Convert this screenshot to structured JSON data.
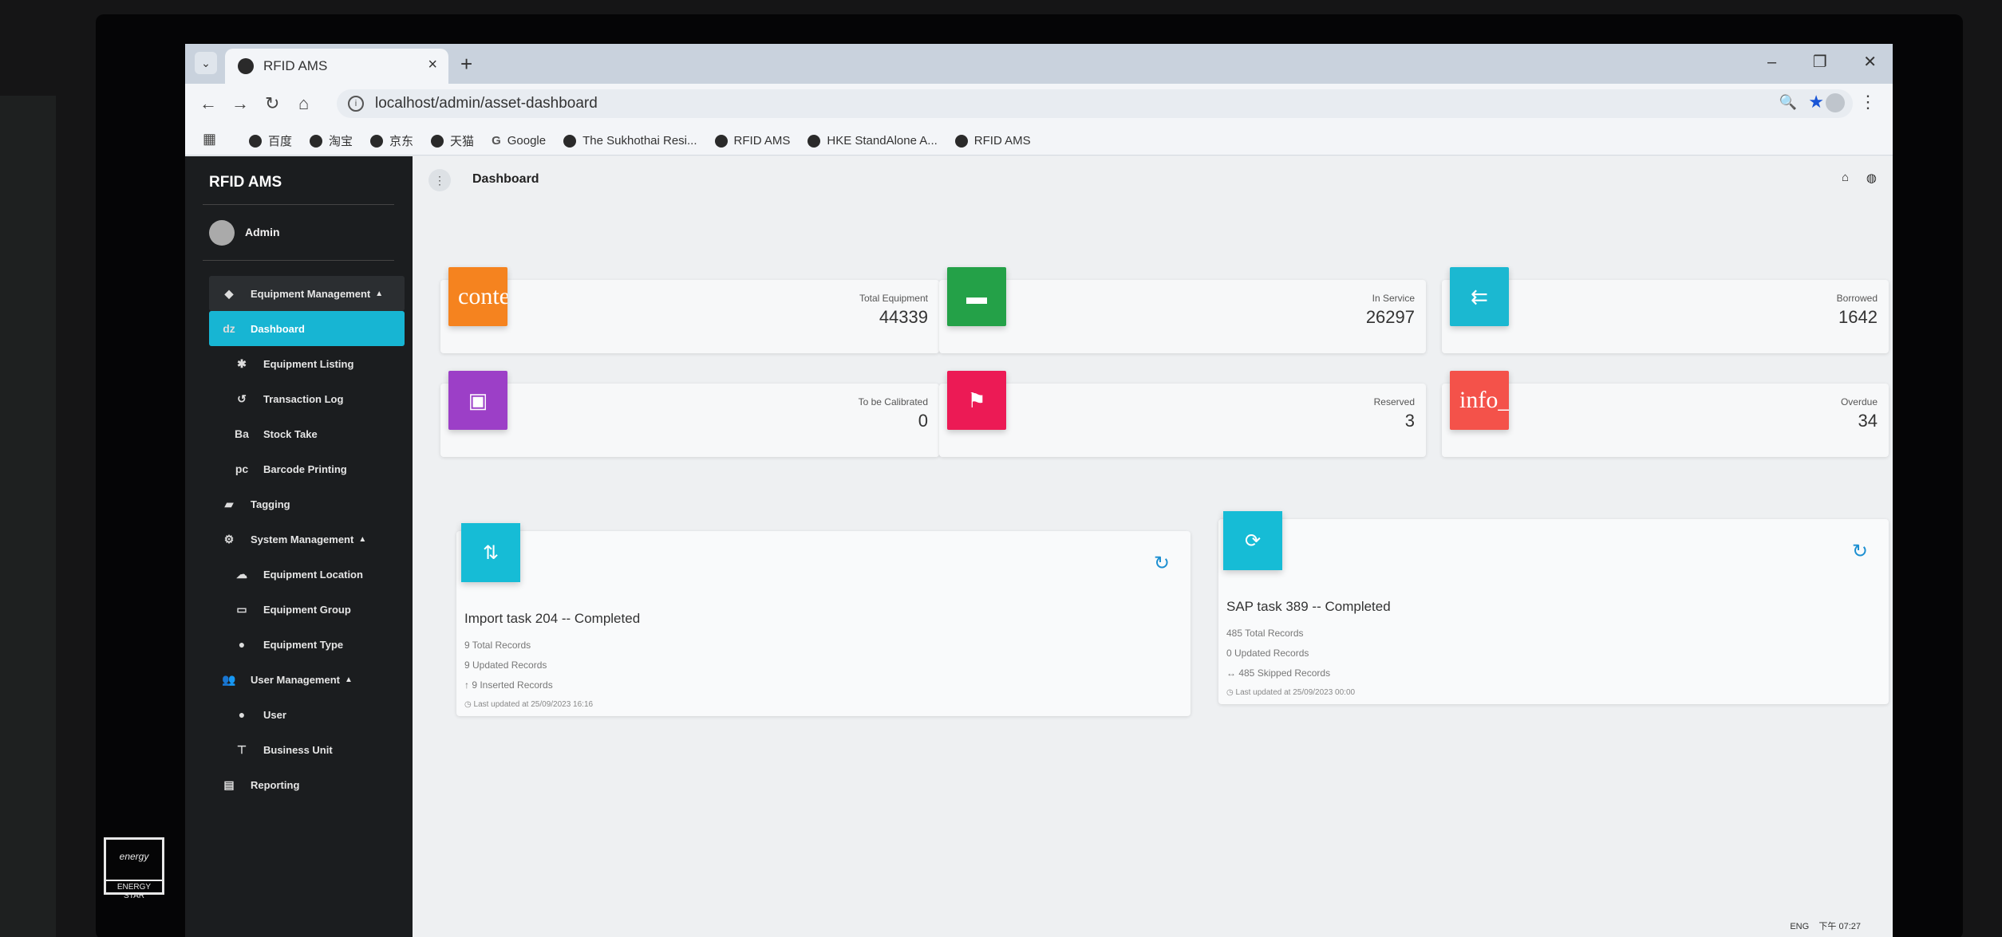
{
  "browser": {
    "tab_title": "RFID AMS",
    "tab_close": "×",
    "new_tab": "+",
    "url": "localhost/admin/asset-dashboard",
    "bookmarks": [
      "百度",
      "淘宝",
      "京东",
      "天猫",
      "Google",
      "The Sukhothai Resi...",
      "RFID AMS",
      "HKE StandAlone A...",
      "RFID AMS"
    ],
    "window_controls": [
      "–",
      "❐",
      "✕"
    ]
  },
  "sidebar": {
    "brand": "RFID AMS",
    "user": "Admin",
    "items": [
      {
        "label": "Equipment Management",
        "icon": "cubes-icon",
        "glyph": "◆",
        "type": "group",
        "caret": "▲"
      },
      {
        "label": "Dashboard",
        "icon": "dashboard-icon",
        "glyph": "dz",
        "type": "active"
      },
      {
        "label": "Equipment Listing",
        "icon": "list-icon",
        "glyph": "✱",
        "type": "sub"
      },
      {
        "label": "Transaction Log",
        "icon": "log-icon",
        "glyph": "↺",
        "type": "sub"
      },
      {
        "label": "Stock Take",
        "icon": "stock-icon",
        "glyph": "Ba",
        "type": "sub"
      },
      {
        "label": "Barcode Printing",
        "icon": "barcode-icon",
        "glyph": "pc",
        "type": "sub"
      },
      {
        "label": "Tagging",
        "icon": "tag-icon",
        "glyph": "▰",
        "type": "item"
      },
      {
        "label": "System Management",
        "icon": "gear-icon",
        "glyph": "⚙",
        "type": "item",
        "caret": "▲"
      },
      {
        "label": "Equipment Location",
        "icon": "location-icon",
        "glyph": "☁",
        "type": "sub"
      },
      {
        "label": "Equipment Group",
        "icon": "group-icon",
        "glyph": "▭",
        "type": "sub"
      },
      {
        "label": "Equipment Type",
        "icon": "type-icon",
        "glyph": "●",
        "type": "sub"
      },
      {
        "label": "User Management",
        "icon": "users-icon",
        "glyph": "👥",
        "type": "item",
        "caret": "▲"
      },
      {
        "label": "User",
        "icon": "user-icon",
        "glyph": "●",
        "type": "sub"
      },
      {
        "label": "Business Unit",
        "icon": "sitemap-icon",
        "glyph": "⊤",
        "type": "sub"
      },
      {
        "label": "Reporting",
        "icon": "report-icon",
        "glyph": "▤",
        "type": "item"
      }
    ]
  },
  "header": {
    "title": "Dashboard",
    "menu_glyph": "⋮",
    "home_glyph": "⌂",
    "globe_glyph": "◍"
  },
  "stats": [
    {
      "label": "Total Equipment",
      "value": "44339",
      "color": "#f5831f",
      "icon_text": "conte",
      "icon": "broken-image-icon"
    },
    {
      "label": "In Service",
      "value": "26297",
      "color": "#24a148",
      "icon_text": "▬",
      "icon": "store-icon"
    },
    {
      "label": "Borrowed",
      "value": "1642",
      "color": "#1bb8d1",
      "icon_text": "⇇",
      "icon": "reply-all-icon"
    },
    {
      "label": "To be Calibrated",
      "value": "0",
      "color": "#9c3fc7",
      "icon_text": "▣",
      "icon": "book-icon"
    },
    {
      "label": "Reserved",
      "value": "3",
      "color": "#ec1a55",
      "icon_text": "⚑",
      "icon": "person-cart-icon"
    },
    {
      "label": "Overdue",
      "value": "34",
      "color": "#f4524a",
      "icon_text": "info_",
      "icon": "info-icon"
    }
  ],
  "tasks": [
    {
      "title": "Import task 204 -- Completed",
      "icon_glyph": "⇅",
      "refresh_glyph": "↻",
      "lines": [
        "9 Total Records",
        "9 Updated Records",
        "↑  9 Inserted Records"
      ],
      "updated": "◷ Last updated at 25/09/2023 16:16"
    },
    {
      "title": "SAP task 389 -- Completed",
      "icon_glyph": "⟳",
      "refresh_glyph": "↻",
      "lines": [
        "485 Total Records",
        "0 Updated Records",
        "↔  485 Skipped Records"
      ],
      "updated": "◷ Last updated at 25/09/2023 00:00"
    }
  ],
  "taskbar": {
    "clock": "下午 07:27",
    "lang": "ENG"
  },
  "energy_star": {
    "script": "energy",
    "label": "ENERGY STAR"
  }
}
